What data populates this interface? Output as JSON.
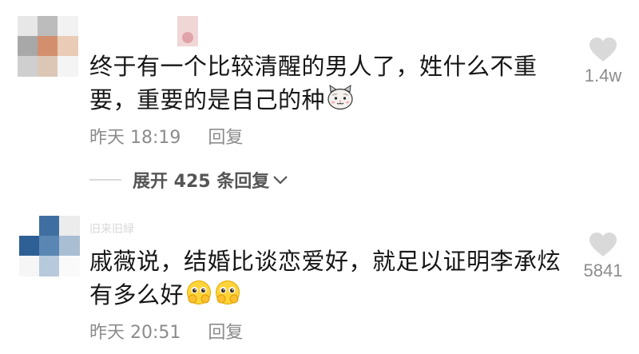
{
  "comments": [
    {
      "username": "",
      "text_line1": "终于有一个比较清醒的男人了，姓什么不重",
      "text_line2": "要，重要的是自己的种",
      "emoji": "cat-face-emoji",
      "time": "昨天 18:19",
      "reply_label": "回复",
      "likes": "1.4w",
      "expand_label": "展开 425 条回复",
      "avatar_icon": "avatar"
    },
    {
      "username": "旧来旧緑",
      "text_line1": "戚薇说，结婚比谈恋爱好，就足以证明李承炫",
      "text_line2": "有多么好",
      "emoji": "pleading-face-hands-emoji",
      "time": "昨天 20:51",
      "reply_label": "回复",
      "likes": "5841",
      "avatar_icon": "avatar"
    }
  ],
  "colors": {
    "text": "#161616",
    "meta": "#8c8c8c",
    "heart": "#d9d9d9",
    "expand": "#555555"
  }
}
